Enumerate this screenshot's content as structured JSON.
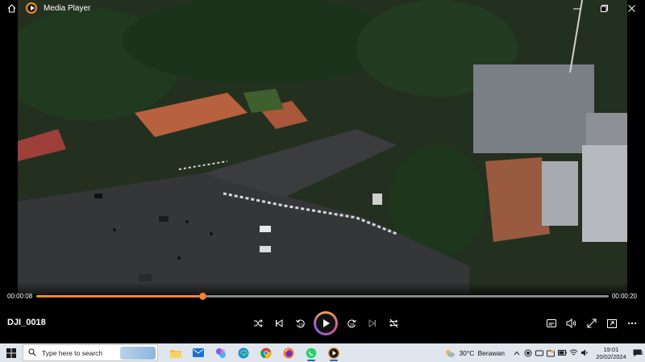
{
  "window": {
    "title": "Media Player",
    "controls": [
      "minimize-icon",
      "maximize-icon",
      "close-icon"
    ]
  },
  "player": {
    "video_title": "DJI_0018",
    "current_time": "00:00:08",
    "total_time": "00:00:20",
    "progress": 0.29,
    "accent": "#f2883a",
    "left_controls": [
      "shuffle-icon",
      "previous-icon",
      "rewind-10-icon",
      "play-icon",
      "forward-30-icon",
      "next-icon",
      "repeat-off-icon"
    ],
    "right_controls": [
      "caption-icon",
      "volume-icon",
      "fullscreen-icon",
      "miniplayer-icon",
      "more-icon"
    ]
  },
  "taskbar": {
    "search_placeholder": "Type here to search",
    "apps": [
      "file-explorer-icon",
      "mail-icon",
      "copilot-icon",
      "edge-icon",
      "chrome-icon",
      "firefox-icon",
      "whatsapp-icon",
      "media-player-icon"
    ],
    "weather_temp": "30°C",
    "weather_text": "Berawan",
    "time": "19:01",
    "date": "20/02/2024",
    "notification_count": "1"
  }
}
